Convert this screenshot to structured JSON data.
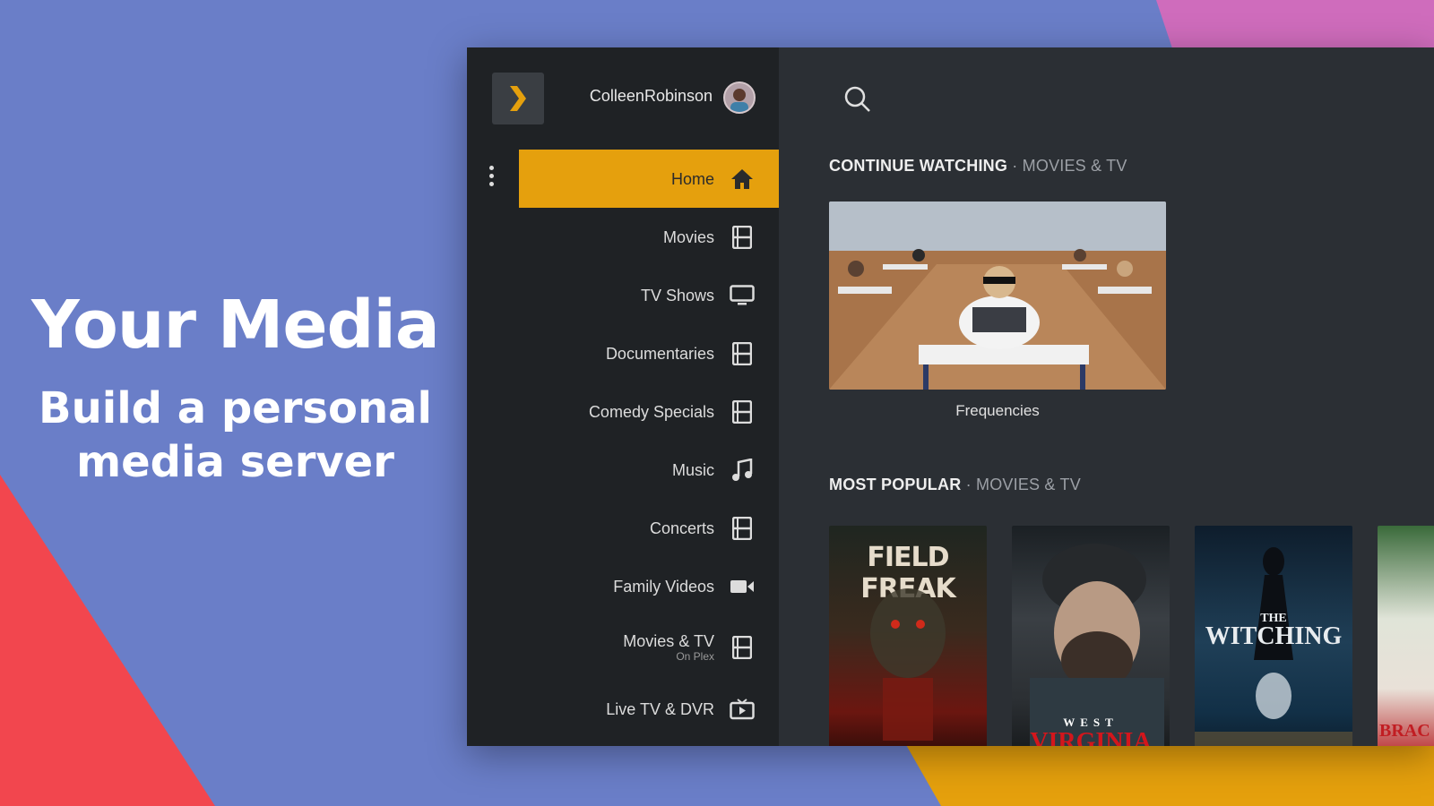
{
  "promo": {
    "title": "Your Media",
    "subtitle": "Build a personal media server"
  },
  "user": {
    "name": "ColleenRobinson"
  },
  "menu": [
    {
      "label": "Home",
      "icon": "home-icon",
      "active": true
    },
    {
      "label": "Movies",
      "icon": "film-icon"
    },
    {
      "label": "TV Shows",
      "icon": "tv-icon"
    },
    {
      "label": "Documentaries",
      "icon": "film-icon"
    },
    {
      "label": "Comedy Specials",
      "icon": "film-icon"
    },
    {
      "label": "Music",
      "icon": "music-note-icon"
    },
    {
      "label": "Concerts",
      "icon": "film-icon"
    },
    {
      "label": "Family Videos",
      "icon": "video-camera-icon"
    },
    {
      "label": "Movies & TV",
      "sublabel": "On Plex",
      "icon": "film-icon"
    },
    {
      "label": "Live TV & DVR",
      "icon": "live-tv-icon"
    }
  ],
  "continue_watching": {
    "title": "CONTINUE WATCHING",
    "context": "MOVIES & TV",
    "items": [
      {
        "title": "Frequencies"
      }
    ]
  },
  "most_popular": {
    "title": "MOST POPULAR",
    "context": "MOVIES & TV",
    "posters": [
      {
        "text": "FIELD FREAK"
      },
      {
        "text_small": "WEST",
        "text": "VIRGINIA"
      },
      {
        "text_small": "THE",
        "text": "WITCHING"
      },
      {
        "text": "BRAC"
      }
    ]
  },
  "colors": {
    "accent": "#e5a00d",
    "sidebar": "#1f2225",
    "panel": "#2b2f34",
    "bg_blue": "#6a7ec8",
    "bg_red": "#f2464e",
    "bg_pink": "#cf6cbc"
  }
}
